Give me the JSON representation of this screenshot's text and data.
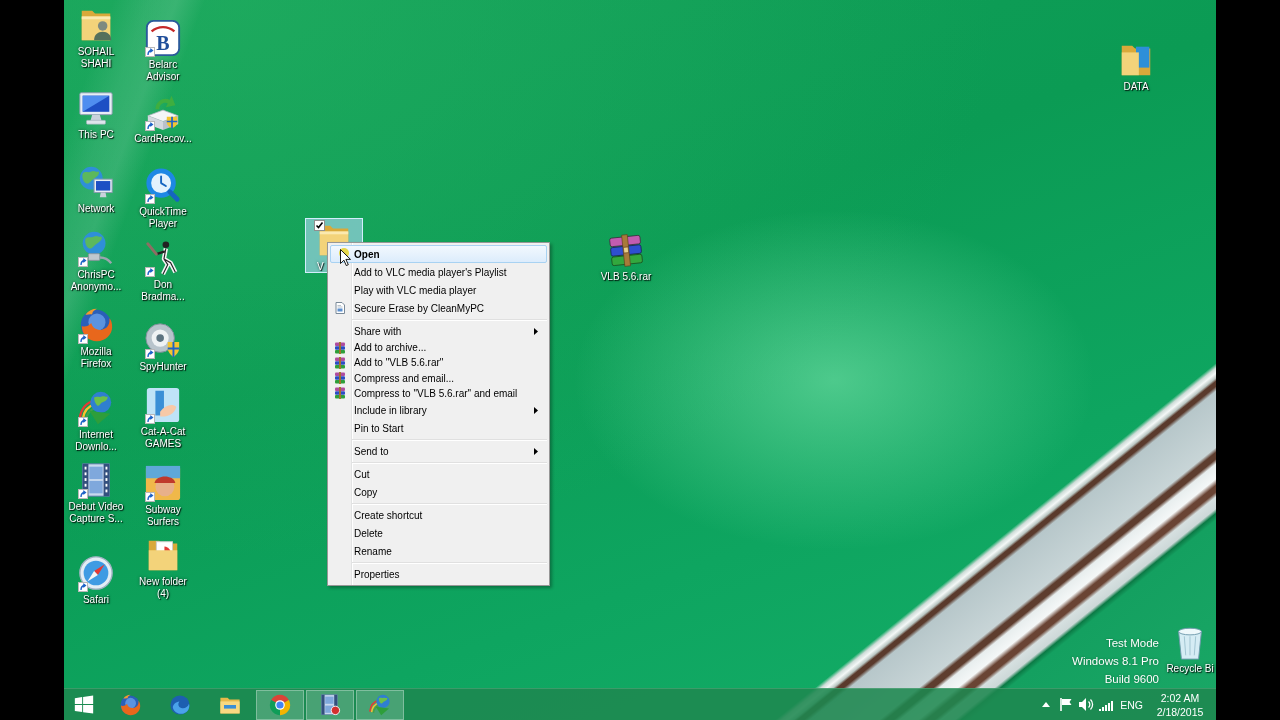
{
  "desktop": {
    "icons": [
      {
        "label": "SOHAIL SHAHI",
        "shortcut": false,
        "selected": false
      },
      {
        "label": "This PC",
        "shortcut": false,
        "selected": false
      },
      {
        "label": "Network",
        "shortcut": false,
        "selected": false
      },
      {
        "label": "ChrisPC Anonymo...",
        "shortcut": true,
        "selected": false
      },
      {
        "label": "Mozilla Firefox",
        "shortcut": true,
        "selected": false
      },
      {
        "label": "Internet Downlo...",
        "shortcut": true,
        "selected": false
      },
      {
        "label": "Debut Video Capture S...",
        "shortcut": true,
        "selected": false
      },
      {
        "label": "Safari",
        "shortcut": true,
        "selected": false
      },
      {
        "label": "Belarc Advisor",
        "shortcut": true,
        "selected": false,
        "logo_letter": "B"
      },
      {
        "label": "CardRecov...",
        "shortcut": true,
        "selected": false
      },
      {
        "label": "QuickTime Player",
        "shortcut": true,
        "selected": false
      },
      {
        "label": "Don Bradma...",
        "shortcut": true,
        "selected": false
      },
      {
        "label": "SpyHunter",
        "shortcut": true,
        "selected": false
      },
      {
        "label": "Cat-A-Cat GAMES",
        "shortcut": true,
        "selected": false
      },
      {
        "label": "Subway Surfers",
        "shortcut": true,
        "selected": false
      },
      {
        "label": "New folder (4)",
        "shortcut": false,
        "selected": false
      },
      {
        "label": "V",
        "shortcut": false,
        "selected": true
      },
      {
        "label": "VLB 5.6.rar",
        "shortcut": false,
        "selected": false
      },
      {
        "label": "DATA",
        "shortcut": false,
        "selected": false
      },
      {
        "label": "Recycle Bi",
        "shortcut": false,
        "selected": false
      }
    ],
    "watermark": [
      "Test Mode",
      "Windows 8.1 Pro",
      "Build 9600"
    ]
  },
  "context_menu": {
    "groups": [
      [
        {
          "label": "Open",
          "kind": "plain",
          "selected": true,
          "default": true,
          "submenu": false
        },
        {
          "label": "Add to VLC media player's Playlist",
          "kind": "plain",
          "selected": false,
          "default": false,
          "submenu": false
        },
        {
          "label": "Play with VLC media player",
          "kind": "plain",
          "selected": false,
          "default": false,
          "submenu": false
        },
        {
          "label": "Secure Erase by CleanMyPC",
          "kind": "erase",
          "selected": false,
          "default": false,
          "submenu": false
        }
      ],
      [
        {
          "label": "Share with",
          "kind": "plain",
          "selected": false,
          "default": false,
          "submenu": true
        },
        {
          "label": "Add to archive...",
          "kind": "archive",
          "selected": false,
          "default": false,
          "submenu": false
        },
        {
          "label": "Add to \"VLB 5.6.rar\"",
          "kind": "archive",
          "selected": false,
          "default": false,
          "submenu": false
        },
        {
          "label": "Compress and email...",
          "kind": "archive",
          "selected": false,
          "default": false,
          "submenu": false
        },
        {
          "label": "Compress to \"VLB 5.6.rar\" and email",
          "kind": "archive",
          "selected": false,
          "default": false,
          "submenu": false
        },
        {
          "label": "Include in library",
          "kind": "plain",
          "selected": false,
          "default": false,
          "submenu": true
        },
        {
          "label": "Pin to Start",
          "kind": "plain",
          "selected": false,
          "default": false,
          "submenu": false
        }
      ],
      [
        {
          "label": "Send to",
          "kind": "plain",
          "selected": false,
          "default": false,
          "submenu": true
        }
      ],
      [
        {
          "label": "Cut",
          "kind": "plain",
          "selected": false,
          "default": false,
          "submenu": false
        },
        {
          "label": "Copy",
          "kind": "plain",
          "selected": false,
          "default": false,
          "submenu": false
        }
      ],
      [
        {
          "label": "Create shortcut",
          "kind": "plain",
          "selected": false,
          "default": false,
          "submenu": false
        },
        {
          "label": "Delete",
          "kind": "plain",
          "selected": false,
          "default": false,
          "submenu": false
        },
        {
          "label": "Rename",
          "kind": "plain",
          "selected": false,
          "default": false,
          "submenu": false
        }
      ],
      [
        {
          "label": "Properties",
          "kind": "plain",
          "selected": false,
          "default": false,
          "submenu": false
        }
      ]
    ]
  },
  "taskbar": {
    "apps": [
      {
        "running": false
      },
      {
        "running": false
      },
      {
        "running": false
      },
      {
        "running": true
      },
      {
        "running": true
      },
      {
        "running": true
      }
    ],
    "tray": {
      "language": "ENG",
      "time": "2:02 AM",
      "date": "2/18/2015"
    }
  }
}
